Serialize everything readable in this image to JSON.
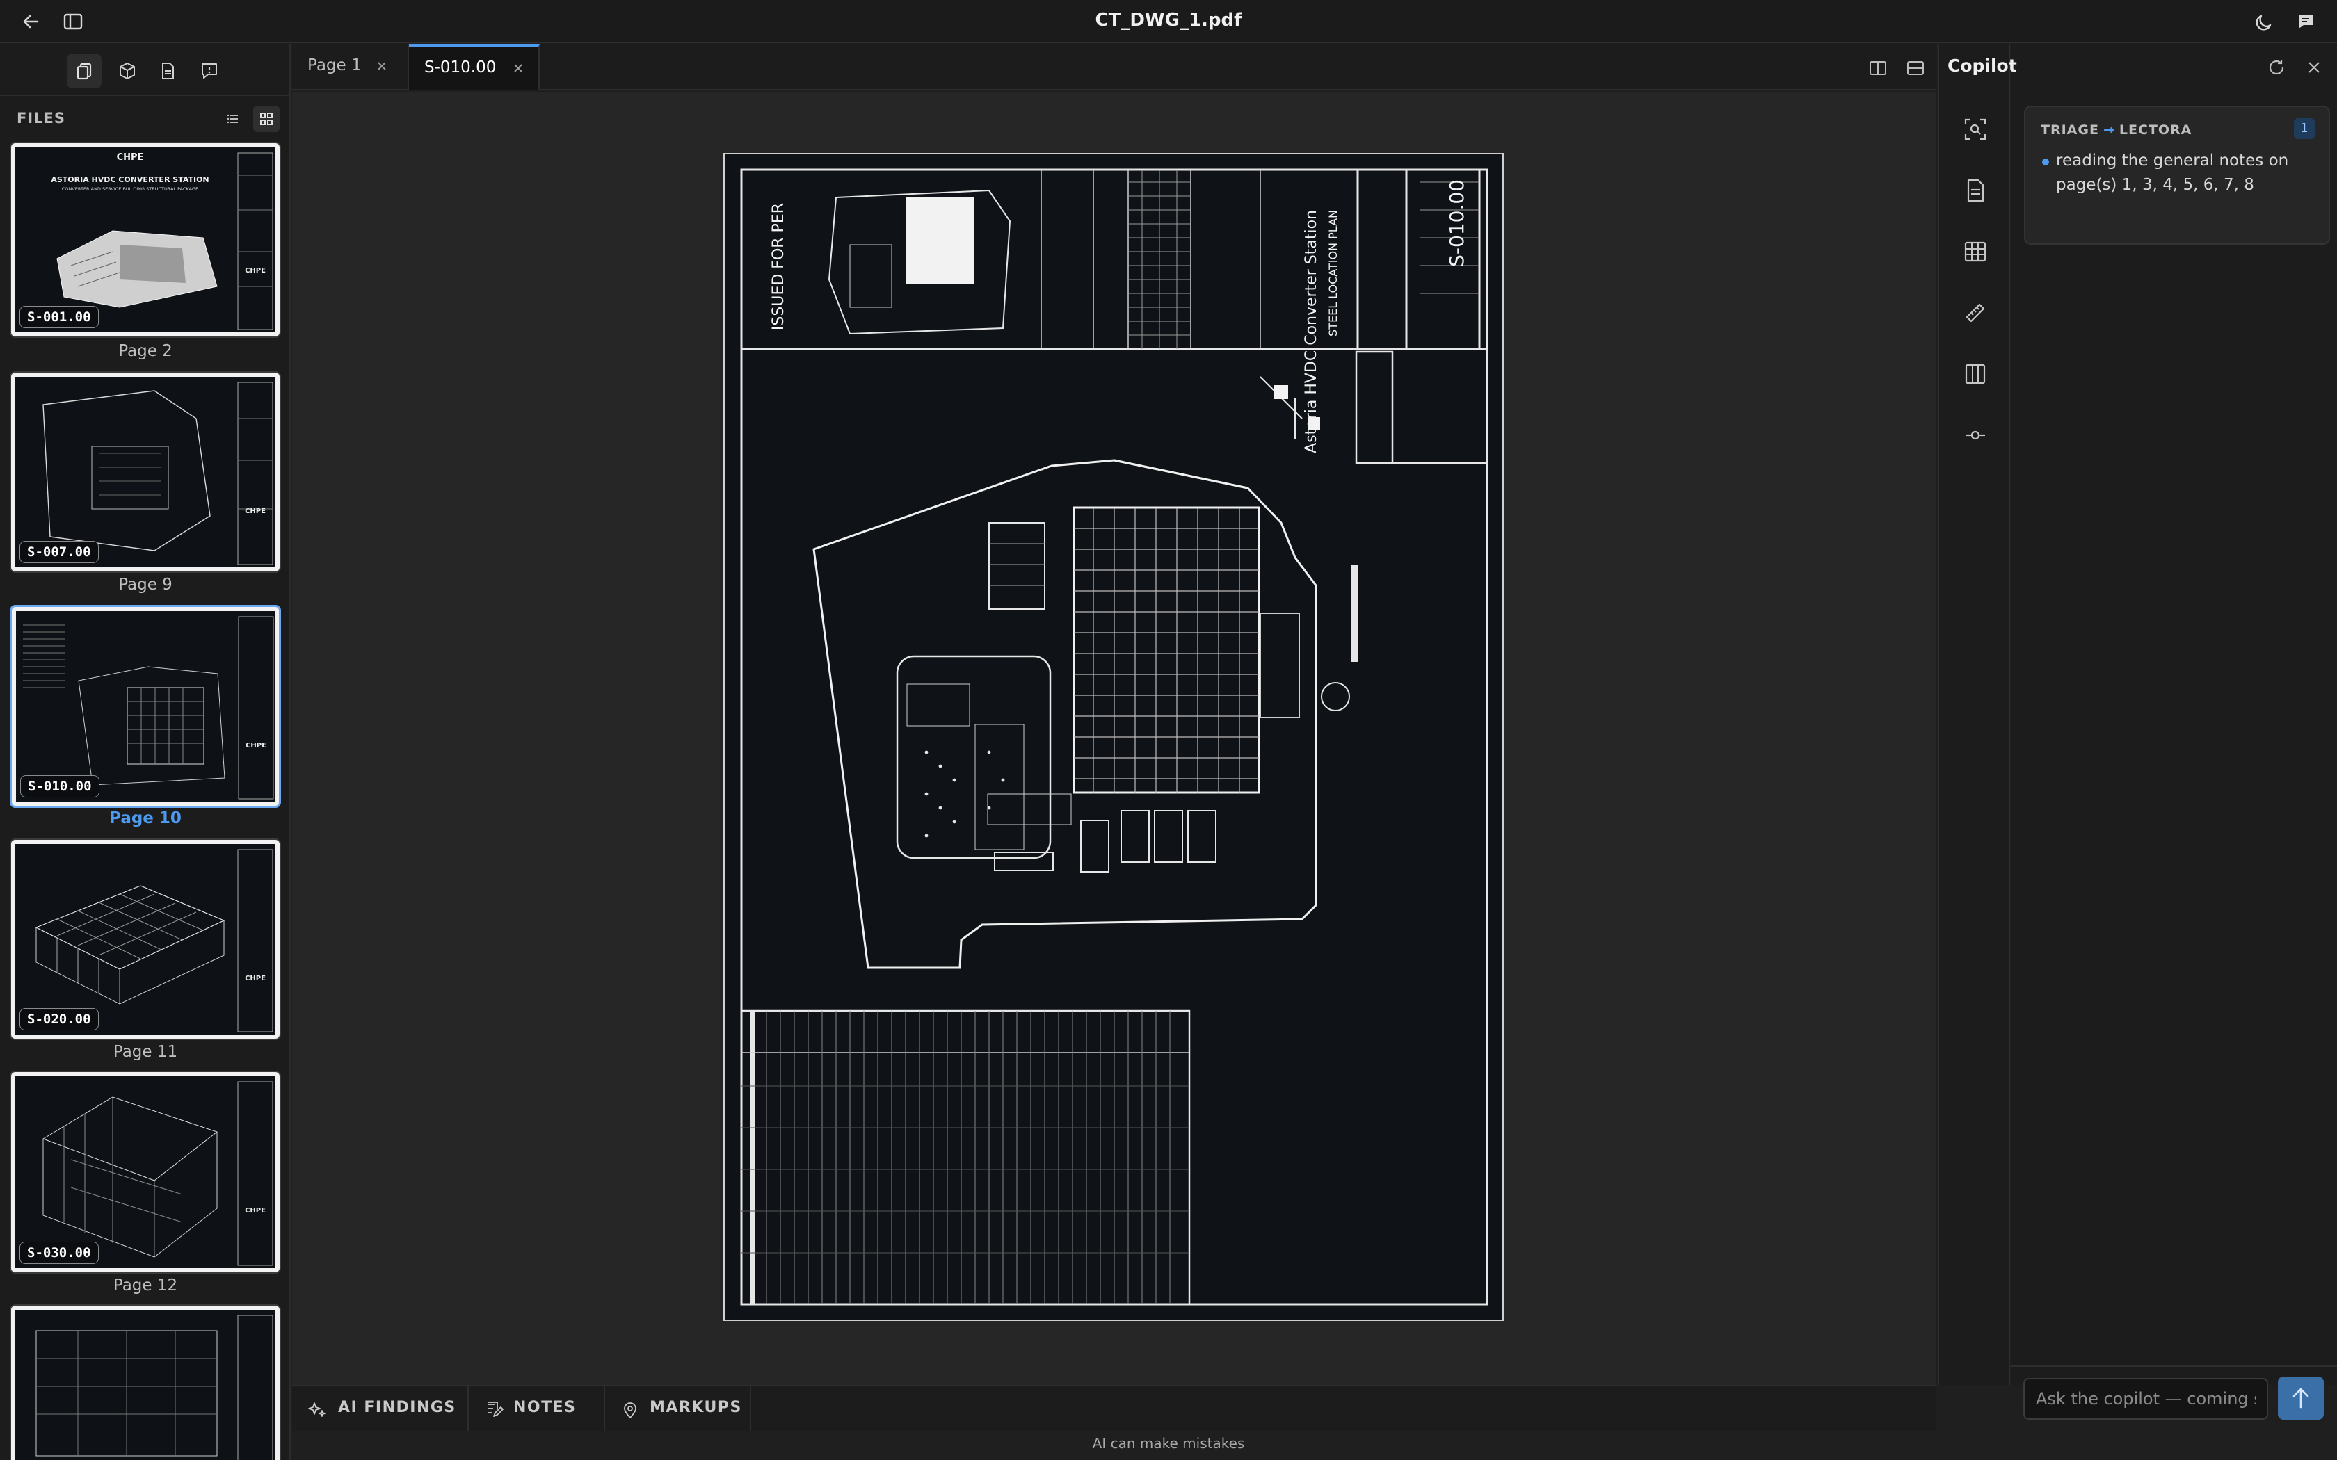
{
  "window": {
    "title": "CT_DWG_1.pdf"
  },
  "sidebar": {
    "files_label": "FILES",
    "thumbnails": [
      {
        "badge": "S-001.00",
        "label": "Page 2",
        "title": "CHPE",
        "subtitle": "ASTORIA HVDC CONVERTER STATION",
        "subsubtitle": "CONVERTER AND SERVICE BUILDING STRUCTURAL PACKAGE"
      },
      {
        "badge": "S-007.00",
        "label": "Page 9"
      },
      {
        "badge": "S-010.00",
        "label": "Page 10",
        "selected": true
      },
      {
        "badge": "S-020.00",
        "label": "Page 11"
      },
      {
        "badge": "S-030.00",
        "label": "Page 12"
      },
      {
        "badge": "",
        "label": ""
      }
    ]
  },
  "tabs": [
    {
      "label": "Page 1",
      "active": false
    },
    {
      "label": "S-010.00",
      "active": true
    }
  ],
  "drawing": {
    "stamp": "ISSUED FOR PER",
    "project": "Astoria HVDC Converter Station",
    "sheet_title": "STEEL LOCATION PLAN",
    "sheet_number": "S-010.00"
  },
  "bottom_tabs": [
    {
      "label": "AI FINDINGS"
    },
    {
      "label": "NOTES"
    },
    {
      "label": "MARKUPS"
    }
  ],
  "disclaimer": "AI can make mistakes",
  "copilot": {
    "title": "Copilot",
    "card": {
      "from": "TRIAGE",
      "to": "LECTORA",
      "count": "1",
      "message": "reading the general notes on page(s) 1, 3, 4, 5, 6, 7, 8"
    },
    "input_placeholder": "Ask the copilot — coming soon"
  },
  "icons": {
    "back": "arrow-left-icon",
    "sidebar_toggle": "sidebar-toggle-icon",
    "theme": "moon-icon",
    "chat": "chat-icon",
    "rail": [
      "scan-search-icon",
      "document-icon",
      "table-icon",
      "ruler-icon",
      "columns-icon",
      "commit-icon"
    ]
  },
  "colors": {
    "accent": "#4d9bf0",
    "background": "#1f1f1f",
    "sheet": "#0f1217"
  }
}
